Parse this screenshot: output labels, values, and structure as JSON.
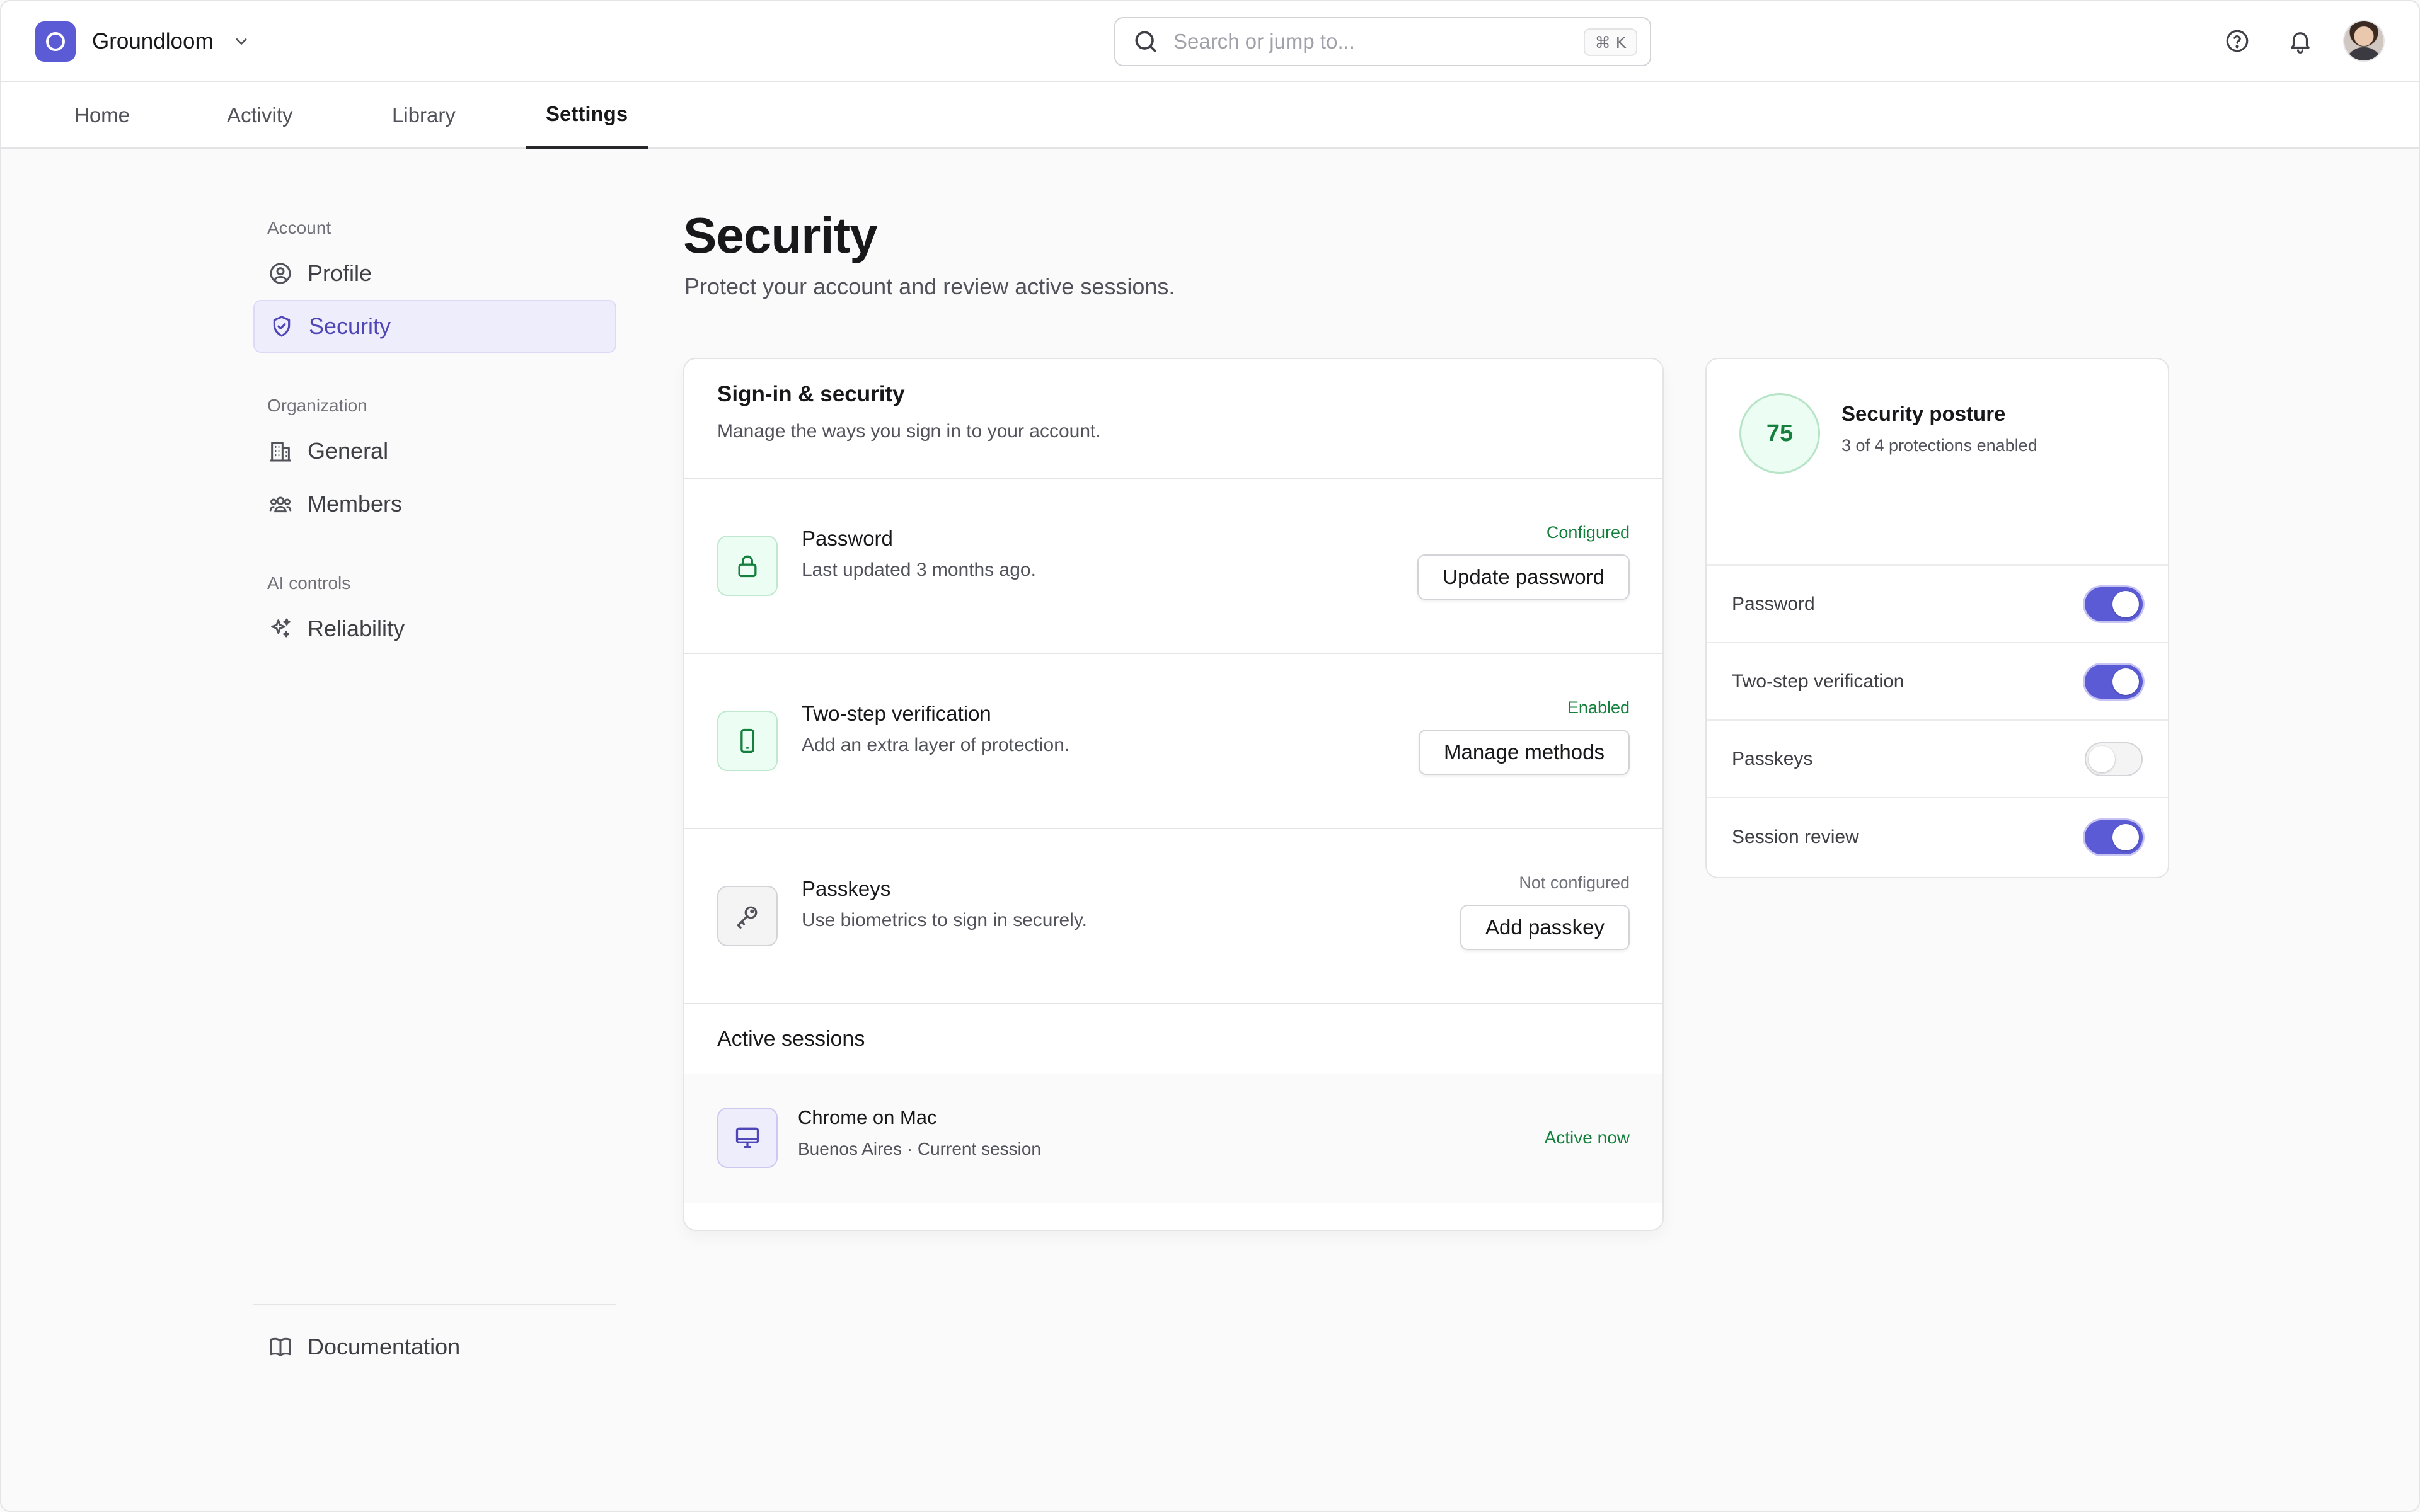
{
  "app": {
    "name": "Groundloom",
    "accent_color": "#5b5bd6"
  },
  "search": {
    "placeholder": "Search or jump to...",
    "shortcut": "⌘ K"
  },
  "top_icons": [
    "help-icon",
    "bell-icon",
    "avatar"
  ],
  "tabs": [
    {
      "label": "Home",
      "active": false
    },
    {
      "label": "Activity",
      "active": false
    },
    {
      "label": "Library",
      "active": false
    },
    {
      "label": "Settings",
      "active": true
    }
  ],
  "sidebar": {
    "groups": [
      {
        "label": "Account",
        "items": [
          {
            "label": "Profile",
            "icon": "user-circle-icon",
            "active": false
          },
          {
            "label": "Security",
            "icon": "shield-icon",
            "active": true
          }
        ]
      },
      {
        "label": "Organization",
        "items": [
          {
            "label": "General",
            "icon": "building-icon",
            "active": false
          },
          {
            "label": "Members",
            "icon": "users-icon",
            "active": false
          }
        ]
      },
      {
        "label": "AI controls",
        "items": [
          {
            "label": "Reliability",
            "icon": "sparkle-icon",
            "active": false
          }
        ]
      }
    ],
    "footer": {
      "label": "Documentation",
      "icon": "book-icon"
    }
  },
  "page": {
    "title": "Security",
    "subtitle": "Protect your account and review active sessions."
  },
  "signin_card": {
    "title": "Sign-in & security",
    "description": "Manage the ways you sign in to your account.",
    "rows": [
      {
        "title": "Password",
        "description": "Last updated 3 months ago.",
        "status": "Configured",
        "button": "Update password",
        "icon": "lock-icon"
      },
      {
        "title": "Two-step verification",
        "description": "Add an extra layer of protection.",
        "status": "Enabled",
        "button": "Manage methods",
        "icon": "phone-icon"
      },
      {
        "title": "Passkeys",
        "description": "Use biometrics to sign in securely.",
        "status": "Not configured",
        "button": "Add passkey",
        "icon": "key-icon"
      }
    ],
    "sessions": {
      "heading": "Active sessions",
      "items": [
        {
          "title": "Chrome on Mac",
          "subtitle": "Buenos Aires · Current session",
          "status": "Active now",
          "icon": "monitor-icon"
        }
      ]
    }
  },
  "posture": {
    "score": "75",
    "title": "Security posture",
    "subtitle": "3 of 4 protections enabled",
    "toggles": [
      {
        "label": "Password",
        "on": true
      },
      {
        "label": "Two-step verification",
        "on": true
      },
      {
        "label": "Passkeys",
        "on": false
      },
      {
        "label": "Session review",
        "on": true
      }
    ]
  }
}
